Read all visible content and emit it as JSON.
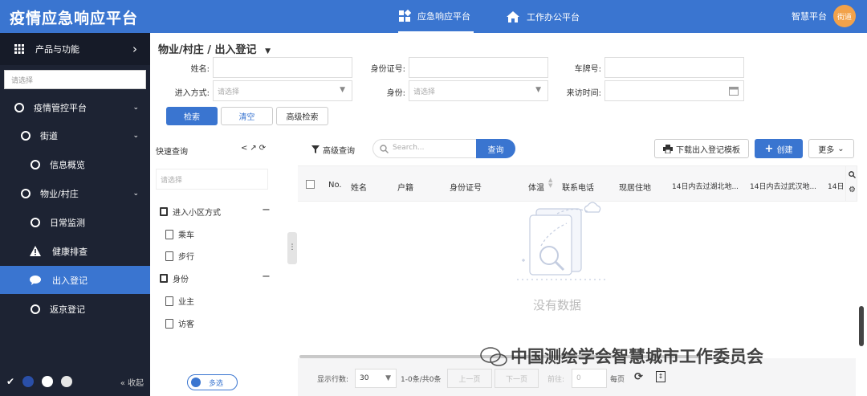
{
  "header": {
    "app_title": "疫情应急响应平台",
    "tabs": [
      {
        "label": "应急响应平台",
        "active": true
      },
      {
        "label": "工作办公平台",
        "active": false
      }
    ],
    "platform_label": "智慧平台",
    "avatar_text": "街道"
  },
  "sidebar": {
    "products_label": "产品与功能",
    "search_placeholder": "请选择",
    "items": [
      {
        "label": "疫情管控平台",
        "icon": "circle-icon",
        "level": 0,
        "expanded": true
      },
      {
        "label": "街道",
        "icon": "circle-icon",
        "level": 1,
        "expanded": true
      },
      {
        "label": "信息概览",
        "icon": "circle-icon",
        "level": 2
      },
      {
        "label": "物业/村庄",
        "icon": "circle-icon",
        "level": 1,
        "expanded": true
      },
      {
        "label": "日常监测",
        "icon": "circle-icon",
        "level": 2
      },
      {
        "label": "健康排查",
        "icon": "warning-icon",
        "level": 2
      },
      {
        "label": "出入登记",
        "icon": "chat-icon",
        "level": 2,
        "active": true
      },
      {
        "label": "返京登记",
        "icon": "circle-icon",
        "level": 2
      }
    ],
    "collapse_label": "收起",
    "theme_colors": [
      "#1d2333",
      "#2a4fa8",
      "#ffffff",
      "#e6e6e6"
    ]
  },
  "page": {
    "breadcrumb": "物业/村庄 / 出入登记",
    "filters": {
      "name_label": "姓名:",
      "id_label": "身份证号:",
      "plate_label": "车牌号:",
      "entry_label": "进入方式:",
      "entry_placeholder": "请选择",
      "identity_label": "身份:",
      "identity_placeholder": "请选择",
      "visit_time_label": "来访时间:"
    },
    "buttons": {
      "search": "检索",
      "clear": "清空",
      "advanced": "高级检索"
    }
  },
  "quick_query": {
    "title": "快速查询",
    "icons": [
      "<",
      "↗",
      "⟳"
    ],
    "search_placeholder": "请选择",
    "groups": [
      {
        "label": "进入小区方式",
        "items": [
          "乘车",
          "步行"
        ]
      },
      {
        "label": "身份",
        "items": [
          "业主",
          "访客"
        ]
      }
    ],
    "multi_select_label": "多选"
  },
  "grid": {
    "advanced_query": "高级查询",
    "search_placeholder": "Search...",
    "query_button": "查询",
    "download_button": "下载出入登记模板",
    "create_button": "创建",
    "more_button": "更多",
    "columns": [
      "No.",
      "姓名",
      "户籍",
      "身份证号",
      "体温",
      "联系电话",
      "现居住地",
      "14日内去过湖北地...",
      "14日内去过武汉地...",
      "14日"
    ],
    "empty_text": "没有数据"
  },
  "pager": {
    "rows_label": "显示行数:",
    "rows_value": "30",
    "range_text": "1-0条/共0条",
    "prev": "上一页",
    "next": "下一页",
    "goto_label": "前往:",
    "goto_value": "0",
    "per_page": "每页"
  },
  "watermark": "中国测绘学会智慧城市工作委员会"
}
